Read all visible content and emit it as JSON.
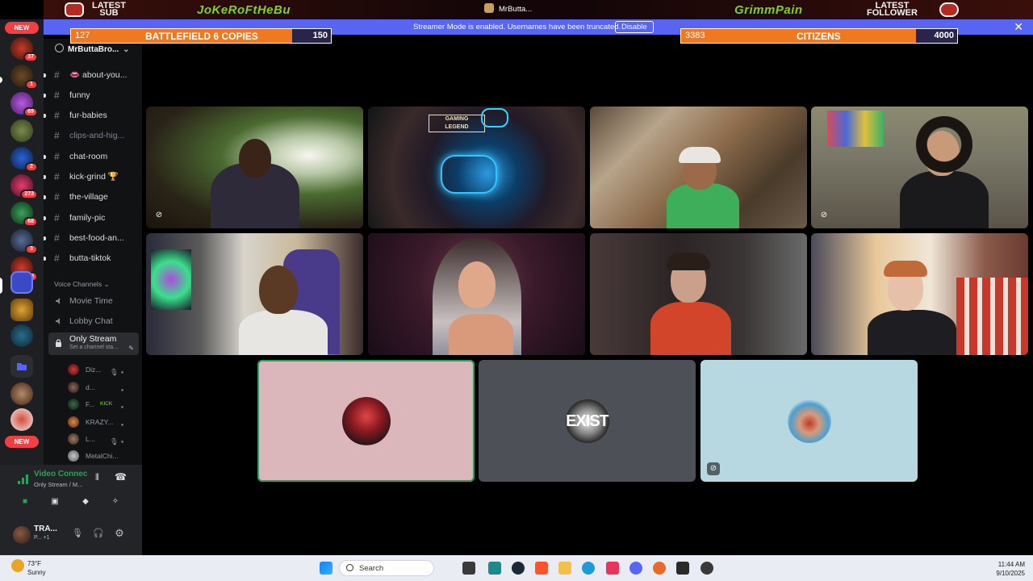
{
  "overlay": {
    "latest_sub_label": "LATEST\nSUB",
    "latest_sub_name": "JoKeRoFtHeBu",
    "tab_title": "MrButta...",
    "latest_follower_label": "LATEST\nFOLLOWER",
    "latest_follower_name": "GrimmPain",
    "goal_left": {
      "current": "127",
      "label": "BATTLEFIELD 6 COPIES",
      "target": "150",
      "progress": 0.85
    },
    "goal_right": {
      "current": "3383",
      "label": "CITIZENS",
      "target": "4000",
      "progress": 0.85
    }
  },
  "streamer_mode": {
    "message": "Streamer Mode is enabled. Usernames have been truncated.",
    "disable_label": "Disable",
    "close_glyph": "✕"
  },
  "rail": {
    "new_top": "NEW",
    "new_bottom": "NEW",
    "badges": [
      "37",
      "1",
      "69",
      "2",
      "273",
      "68",
      "3",
      "38"
    ]
  },
  "sidebar": {
    "server_name": "MrButtaBro...",
    "channels": [
      {
        "name": "👄 about-you..."
      },
      {
        "name": "funny"
      },
      {
        "name": "fur-babies"
      },
      {
        "name": "clips-and-hig..."
      },
      {
        "name": "chat-room"
      },
      {
        "name": "kick-grind 🏆"
      },
      {
        "name": "the-village"
      },
      {
        "name": "family-pic"
      },
      {
        "name": "best-food-an..."
      },
      {
        "name": "butta-tiktok"
      }
    ],
    "voice_header": "Voice Channels",
    "voice_channels": [
      {
        "name": "Movie Time"
      },
      {
        "name": "Lobby Chat"
      }
    ],
    "active_voice": {
      "name": "Only Stream",
      "status": "Set a channel sta..."
    },
    "members": [
      {
        "name": "Diz..."
      },
      {
        "name": "d..."
      },
      {
        "name": "F..."
      },
      {
        "name": "KRAZY..."
      },
      {
        "name": "L..."
      },
      {
        "name": "MetalChi..."
      }
    ],
    "member_kick_tag": "KICK"
  },
  "voice_panel": {
    "status": "Video Connec",
    "location": "Only Stream / M..."
  },
  "user": {
    "name": "TRA...",
    "status": "P... +1"
  },
  "taskbar": {
    "temperature": "73°F",
    "condition": "Sunny",
    "search_label": "Search",
    "time": "11:44 AM",
    "date": "9/10/2025"
  }
}
